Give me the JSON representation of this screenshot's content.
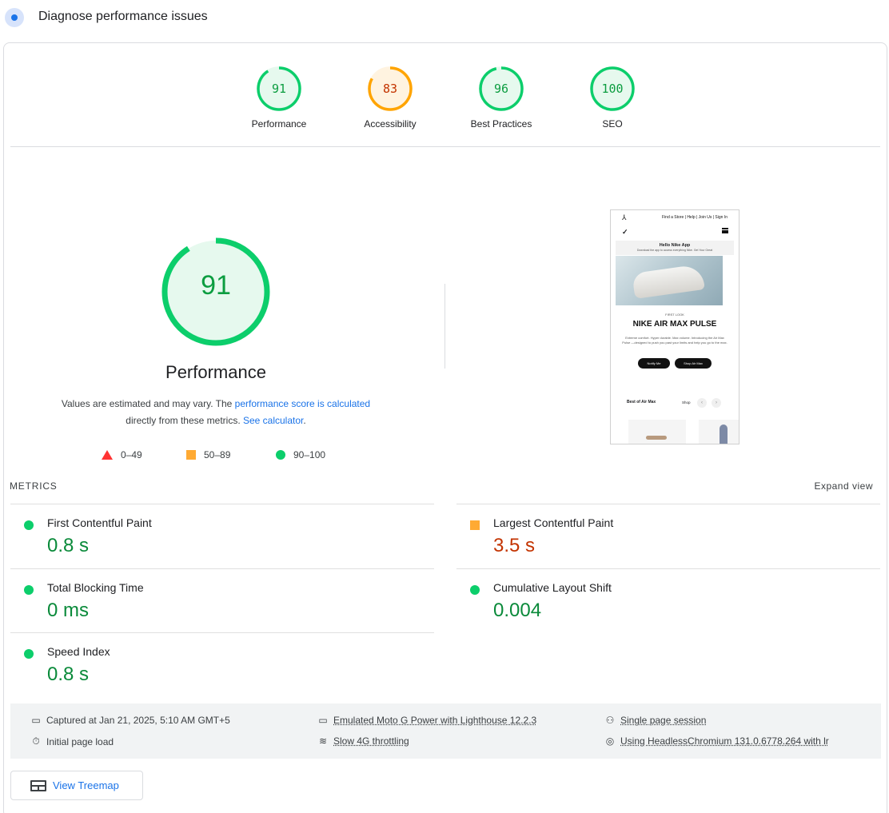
{
  "header": {
    "title": "Diagnose performance issues"
  },
  "categories": [
    {
      "label": "Performance",
      "score": "91",
      "color": "#0cce6b",
      "text_color": "#0c9d40",
      "fraction": 0.91
    },
    {
      "label": "Accessibility",
      "score": "83",
      "color": "#ffa400",
      "text_color": "#c33300",
      "fraction": 0.83
    },
    {
      "label": "Best Practices",
      "score": "96",
      "color": "#0cce6b",
      "text_color": "#0c9d40",
      "fraction": 0.96
    },
    {
      "label": "SEO",
      "score": "100",
      "color": "#0cce6b",
      "text_color": "#0c9d40",
      "fraction": 1.0
    }
  ],
  "performance": {
    "score": "91",
    "fraction": 0.91,
    "title": "Performance",
    "note_prefix": "Values are estimated and may vary. The ",
    "note_link": "performance score is calculated",
    "note_mid": "directly from these metrics. ",
    "note_link2": "See calculator",
    "note_end": "."
  },
  "legend": [
    {
      "shape": "triangle",
      "range": "0–49"
    },
    {
      "shape": "square",
      "range": "50–89"
    },
    {
      "shape": "circle",
      "range": "90–100"
    }
  ],
  "preview": {
    "top_links": "Find a Store | Help | Join Us | Sign In",
    "swoosh": "✓",
    "banner_title": "Hello Nike App",
    "banner_sub": "Download the app to access everything Nike. Get Your Great",
    "small_label": "FIRST LOOK",
    "headline": "NIKE AIR MAX PULSE",
    "copy": "Extreme comfort. Hyper durable. Max volume. Introducing the Air Max Pulse —designed to push you past your limits and help you go to the max.",
    "btn1": "Notify Me",
    "btn2": "Shop Air Max",
    "section": "Best of Air Max",
    "shop": "Shop"
  },
  "metrics": {
    "label": "METRICS",
    "expand": "Expand view",
    "items": [
      {
        "name": "First Contentful Paint",
        "value": "0.8 s",
        "status": "good"
      },
      {
        "name": "Largest Contentful Paint",
        "value": "3.5 s",
        "status": "average"
      },
      {
        "name": "Total Blocking Time",
        "value": "0 ms",
        "status": "good"
      },
      {
        "name": "Cumulative Layout Shift",
        "value": "0.004",
        "status": "good"
      },
      {
        "name": "Speed Index",
        "value": "0.8 s",
        "status": "good"
      }
    ]
  },
  "info": {
    "captured": "Captured at Jan 21, 2025, 5:10 AM GMT+5",
    "load": "Initial page load",
    "device": "Emulated Moto G Power with Lighthouse 12.2.3",
    "throttle": "Slow 4G throttling",
    "session": "Single page session",
    "browser": "Using HeadlessChromium 131.0.6778.264 with lr"
  },
  "treemap": {
    "label": "View Treemap"
  }
}
